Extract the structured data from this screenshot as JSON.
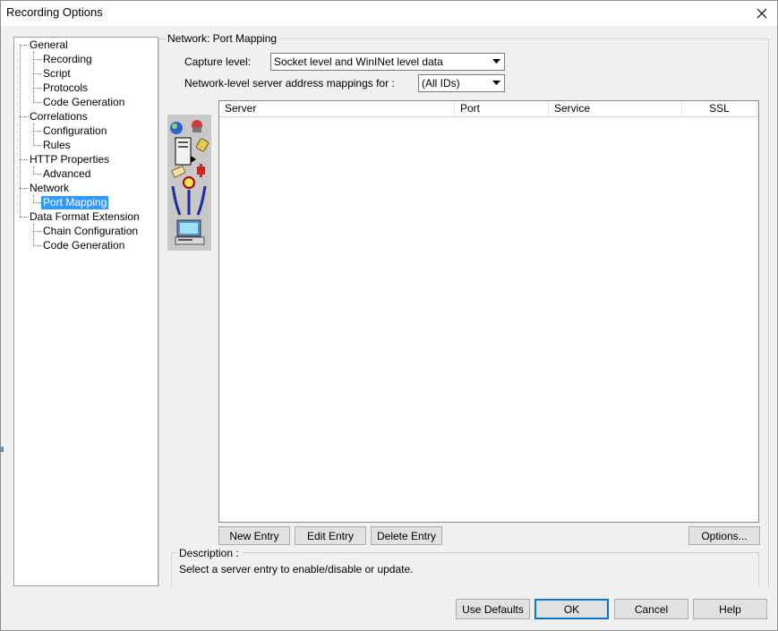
{
  "window": {
    "title": "Recording Options"
  },
  "tree": {
    "items": [
      {
        "label": "General",
        "level": 0
      },
      {
        "label": "Recording",
        "level": 1
      },
      {
        "label": "Script",
        "level": 1
      },
      {
        "label": "Protocols",
        "level": 1
      },
      {
        "label": "Code Generation",
        "level": 1
      },
      {
        "label": "Correlations",
        "level": 0
      },
      {
        "label": "Configuration",
        "level": 1
      },
      {
        "label": "Rules",
        "level": 1
      },
      {
        "label": "HTTP Properties",
        "level": 0
      },
      {
        "label": "Advanced",
        "level": 1
      },
      {
        "label": "Network",
        "level": 0
      },
      {
        "label": "Port Mapping",
        "level": 1,
        "selected": true
      },
      {
        "label": "Data Format Extension",
        "level": 0
      },
      {
        "label": "Chain Configuration",
        "level": 1
      },
      {
        "label": "Code Generation",
        "level": 1
      }
    ]
  },
  "section": {
    "title": "Network: Port Mapping",
    "capture_label": "Capture level:",
    "capture_value": "Socket level and WinINet level data",
    "mappings_label": "Network-level server address mappings for :",
    "mappings_value": "(All IDs)"
  },
  "table": {
    "columns": [
      "Server",
      "Port",
      "Service",
      "SSL"
    ],
    "rows": []
  },
  "entry_buttons": {
    "new": "New Entry",
    "edit": "Edit Entry",
    "delete": "Delete Entry",
    "options": "Options..."
  },
  "description": {
    "title": "Description :",
    "text": "Select a server entry to enable/disable or update."
  },
  "footer": {
    "use_defaults": "Use Defaults",
    "ok": "OK",
    "cancel": "Cancel",
    "help": "Help"
  },
  "colors": {
    "selection": "#3399ff",
    "default_button_border": "#0078d7"
  }
}
